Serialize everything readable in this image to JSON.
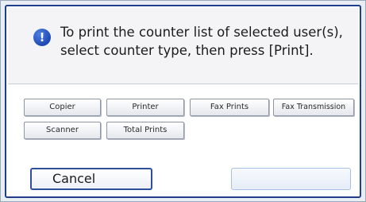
{
  "dialog": {
    "message_lines": [
      "To print the counter list of selected user(s),",
      "select counter type, then press [Print]."
    ],
    "icon": "info-icon",
    "icon_glyph": "!"
  },
  "counter_types": [
    "Copier",
    "Printer",
    "Fax Prints",
    "Fax Transmission",
    "Scanner",
    "Total Prints"
  ],
  "actions": {
    "cancel_label": "Cancel",
    "print_label": ""
  },
  "colors": {
    "dialog_border": "#1f3f8c",
    "icon_blue": "#1e49b5",
    "button_border": "#8e96a3"
  }
}
